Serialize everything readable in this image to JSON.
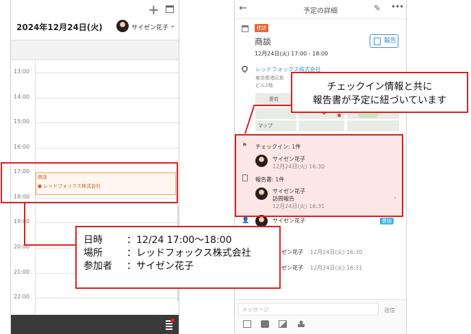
{
  "left_screen": {
    "date_label": "2024年12月24日(火)",
    "user_name": "サイゼン花子",
    "hours": [
      "13:00",
      "14:00",
      "15:00",
      "16:00",
      "17:00",
      "18:00",
      "19:00",
      "20:00",
      "21:00",
      "22:00"
    ],
    "event": {
      "title": "商談",
      "location": "レッドフォックス株式会社"
    }
  },
  "right_screen": {
    "header_title": "予定の詳細",
    "tag": "往訪",
    "subject": "商談",
    "report_button": "報告",
    "datetime": "12月24日(火) 17:00 - 18:00",
    "company": "レッドフォックス株式会社",
    "address_line1": "東京都港区新",
    "address_line2": "ビル2階",
    "map_label": "マップ",
    "map_place": "愛宕",
    "checkin": {
      "header": "チェックイン: 1件",
      "name": "サイゼン花子",
      "time": "12月24日(火) 16:30"
    },
    "report": {
      "header": "報告書: 1件",
      "name": "サイゼン花子",
      "subject": "訪問報告",
      "time": "12月24日(火) 16:31"
    },
    "attendee_name": "サイゼン花子",
    "attendee_badge": "参加",
    "logs": [
      {
        "name": "ゼン花子",
        "time": "12月24日(火) 16:30"
      },
      {
        "name": "ゼン花子",
        "time": "12月24日(火) 16:31"
      }
    ],
    "message_placeholder": "メッセージ",
    "send_label": "送信"
  },
  "annotations": {
    "left_callout": [
      {
        "key": "日時",
        "value": "：12/24 17:00～18:00"
      },
      {
        "key": "場所",
        "value": "：レッドフォックス株式会社"
      },
      {
        "key": "参加者",
        "value": "：サイゼン花子"
      }
    ],
    "right_callout": [
      "チェックイン情報と共に",
      "報告書が予定に紐づいています"
    ]
  },
  "colors": {
    "annotation_red": "#e01b1b",
    "event_orange": "#e8a06a",
    "link_blue": "#3c8fd8",
    "tag_orange": "#e8663a",
    "highlight_pink": "#fde6e6"
  }
}
